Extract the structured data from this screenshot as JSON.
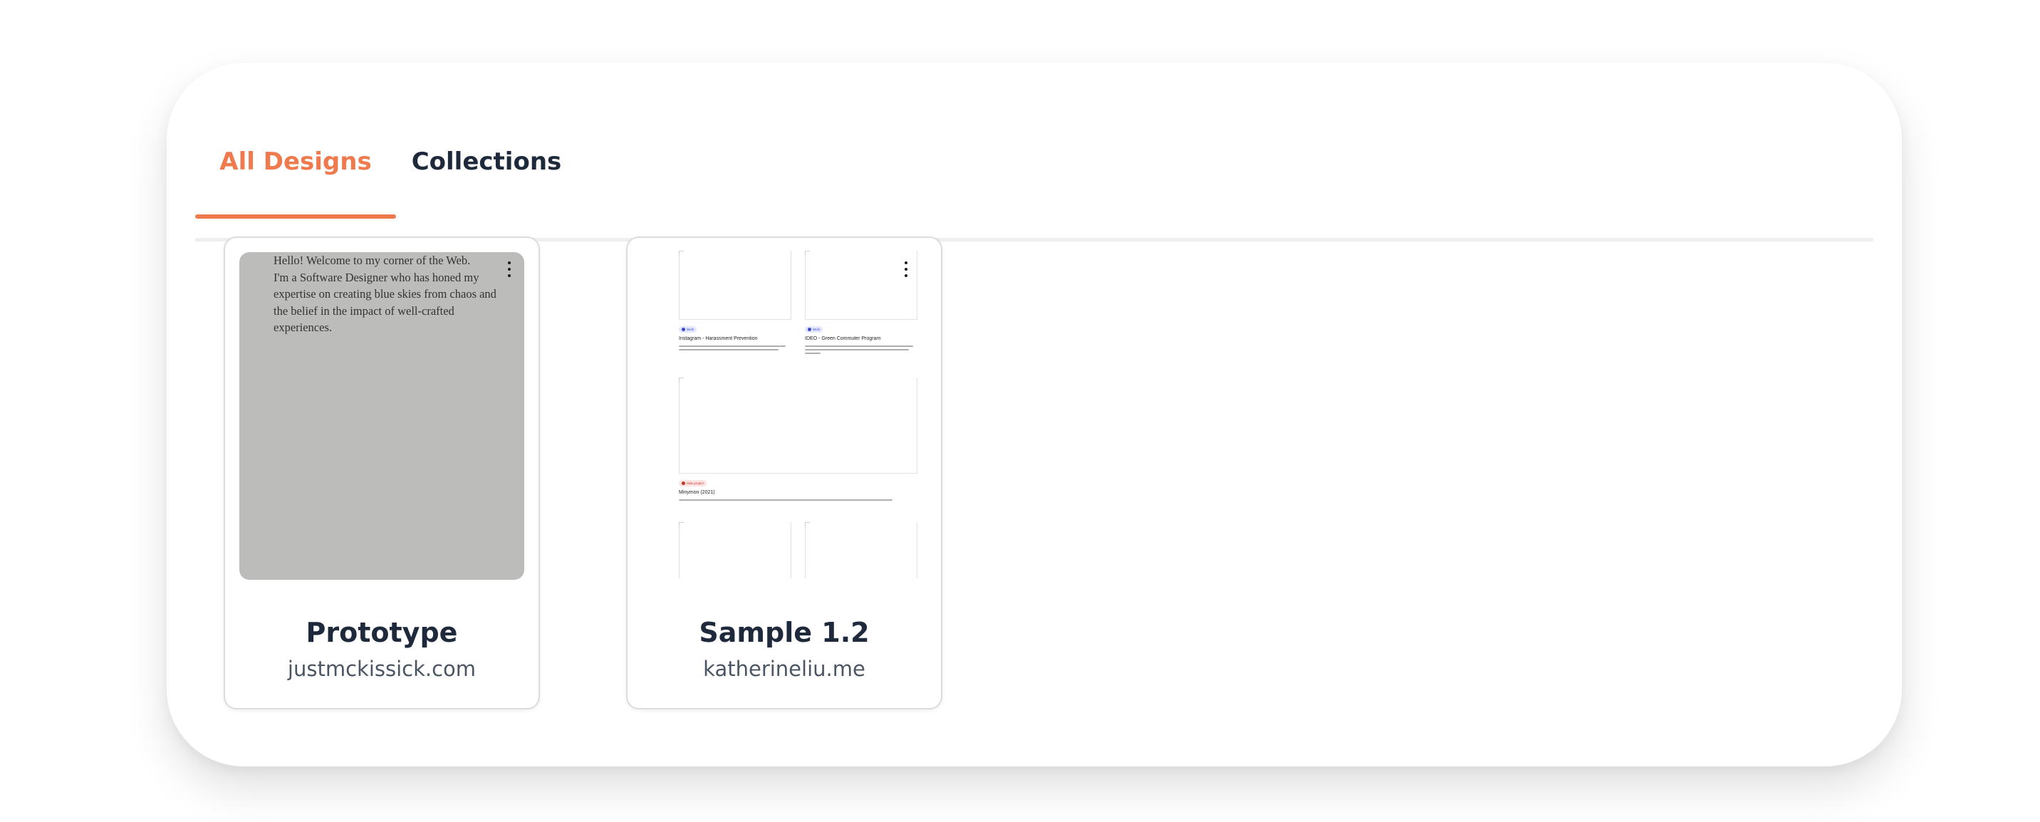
{
  "tabs": [
    {
      "label": "All Designs",
      "active": true
    },
    {
      "label": "Collections",
      "active": false
    }
  ],
  "colors": {
    "accent": "#ee7a4e",
    "title_text": "#1e293b",
    "subtitle_text": "#4b5563",
    "thumbnail_gray": "#bcbcbb"
  },
  "designs": [
    {
      "title": "Prototype",
      "site": "justmckissick.com",
      "preview_lines": [
        "Hello! Welcome to my corner of the Web.",
        "I'm a Software Designer who has honed my",
        "expertise on creating blue skies from chaos and",
        "the belief in the impact of well-crafted",
        "experiences."
      ],
      "menu_icon": "kebab-menu-icon"
    },
    {
      "title": "Sample 1.2",
      "site": "katherineliu.me",
      "preview_projects": [
        {
          "badge": "Work",
          "title": "Instagram - Harassment Prevention"
        },
        {
          "badge": "Work",
          "title": "IDEO - Green Commuter Program"
        },
        {
          "badge": "Side project",
          "title": "Minymon (2021)"
        }
      ],
      "menu_icon": "kebab-menu-icon"
    }
  ]
}
